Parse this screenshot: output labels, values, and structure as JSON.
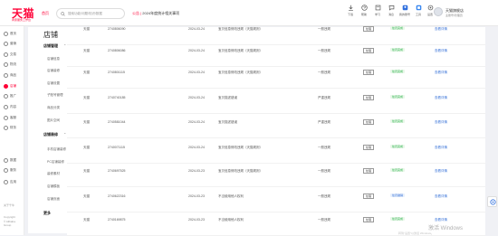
{
  "header": {
    "logo": "天猫",
    "logo_sub": "商家服务工作台",
    "top_tab": "首页",
    "search_placeholder": "搜索功能/问题/知识/数据",
    "notice_prefix": "公告 | ",
    "notice_text": "2024年度统计相关事项",
    "tools": [
      {
        "label": "下载",
        "icon": "download-icon"
      },
      {
        "label": "帮助",
        "icon": "help-icon"
      },
      {
        "label": "学习",
        "icon": "learn-icon"
      },
      {
        "label": "消息",
        "icon": "message-icon"
      },
      {
        "label": "我的账号",
        "icon": "account-icon"
      },
      {
        "label": "工具",
        "icon": "tools-icon"
      },
      {
        "label": "设置",
        "icon": "settings-icon"
      }
    ],
    "user_name": "天猫旗舰店",
    "user_role": "主账号/管理员"
  },
  "sidebar": {
    "items": [
      {
        "label": "首页",
        "icon": "home-icon"
      },
      {
        "label": "营销",
        "icon": "marketing-icon"
      },
      {
        "label": "交易",
        "icon": "trade-icon"
      },
      {
        "label": "物流",
        "icon": "logistics-icon"
      },
      {
        "label": "商品",
        "icon": "goods-icon"
      },
      {
        "label": "店铺",
        "icon": "shop-icon",
        "active": true
      },
      {
        "label": "推广",
        "icon": "promotion-icon"
      },
      {
        "label": "内容",
        "icon": "content-icon"
      },
      {
        "label": "客服",
        "icon": "service-icon"
      },
      {
        "label": "财务",
        "icon": "finance-icon"
      },
      {
        "label": "数据",
        "icon": "data-icon"
      },
      {
        "label": "服务",
        "icon": "service2-icon"
      },
      {
        "label": "应用",
        "icon": "apps-icon"
      }
    ],
    "footer": [
      "关于千牛",
      "Copyright",
      "© Alibaba Group"
    ]
  },
  "subnav": {
    "title": "店铺",
    "groups": [
      {
        "label": "店铺管理",
        "items": [
          "店铺信息",
          "店铺装修",
          "店铺设置",
          "子账号管理",
          "商品分类",
          "图片空间"
        ]
      },
      {
        "label": "店铺装修",
        "items": [
          "手机店铺装修",
          "PC店铺装修",
          "装修素材",
          "店铺模板",
          "店铺页面"
        ]
      },
      {
        "label": "更多",
        "items": []
      }
    ]
  },
  "table": {
    "rows": [
      {
        "platform": "天猫",
        "id": "2740806090",
        "date": "2024-03-24",
        "desc": "宝贝信息修改违规（天猫规则）",
        "type": "一般违规",
        "btn": "处理",
        "status": "处罚完成",
        "status_color": "green",
        "link": "查看详情"
      },
      {
        "platform": "天猫",
        "id": "2740806086",
        "date": "2024-03-24",
        "desc": "宝贝信息修改违规（天猫规则）",
        "type": "一般违规",
        "btn": "处理",
        "status": "处罚完成",
        "status_color": "green",
        "link": "查看详情"
      },
      {
        "platform": "天猫",
        "id": "2740801115",
        "date": "2024-03-24",
        "desc": "宝贝信息修改违规（天猫规则）",
        "type": "一般违规",
        "btn": "处理",
        "status": "处罚完成",
        "status_color": "green",
        "link": "查看详情"
      },
      {
        "platform": "天猫",
        "id": "2740740185",
        "date": "2024-03-24",
        "desc": "宝贝描述错误",
        "type": "严重违规",
        "btn": "处理",
        "status": "处罚完成",
        "status_color": "green",
        "link": "查看详情"
      },
      {
        "platform": "天猫",
        "id": "2740581044",
        "date": "2024-03-24",
        "desc": "宝贝描述错误",
        "type": "严重违规",
        "btn": "处理",
        "status": "处罚完成",
        "status_color": "green",
        "link": "查看详情"
      },
      {
        "platform": "天猫",
        "id": "2740071115",
        "date": "2024-03-24",
        "desc": "宝贝信息修改违规（天猫规则）",
        "type": "一般违规",
        "btn": "处理",
        "status": "处罚完成",
        "status_color": "green",
        "link": "查看详情"
      },
      {
        "platform": "天猫",
        "id": "2740697525",
        "date": "2024-03-23",
        "desc": "宝贝信息修改违规（天猫规则）",
        "type": "一般违规",
        "btn": "处理",
        "status": "处罚完成",
        "status_color": "green",
        "link": "查看详情"
      },
      {
        "platform": "天猫",
        "id": "2740622316",
        "date": "2024-03-23",
        "desc": "不当使用他人权利",
        "type": "一般违规",
        "btn": "处理",
        "status": "处罚撤销",
        "status_color": "blue",
        "link": "查看详情"
      },
      {
        "platform": "天猫",
        "id": "2740169875",
        "date": "2024-03-23",
        "desc": "不当使用他人权利",
        "type": "一般违规",
        "btn": "处理",
        "status": "处罚完成",
        "status_color": "green",
        "link": "查看详情"
      }
    ]
  },
  "watermark": {
    "text": "激活 Windows",
    "sub": "转到“设置”以激活 Windows。"
  },
  "colors": {
    "brand": "#ff0036",
    "link": "#3a74d8",
    "success": "#2bb24c"
  }
}
